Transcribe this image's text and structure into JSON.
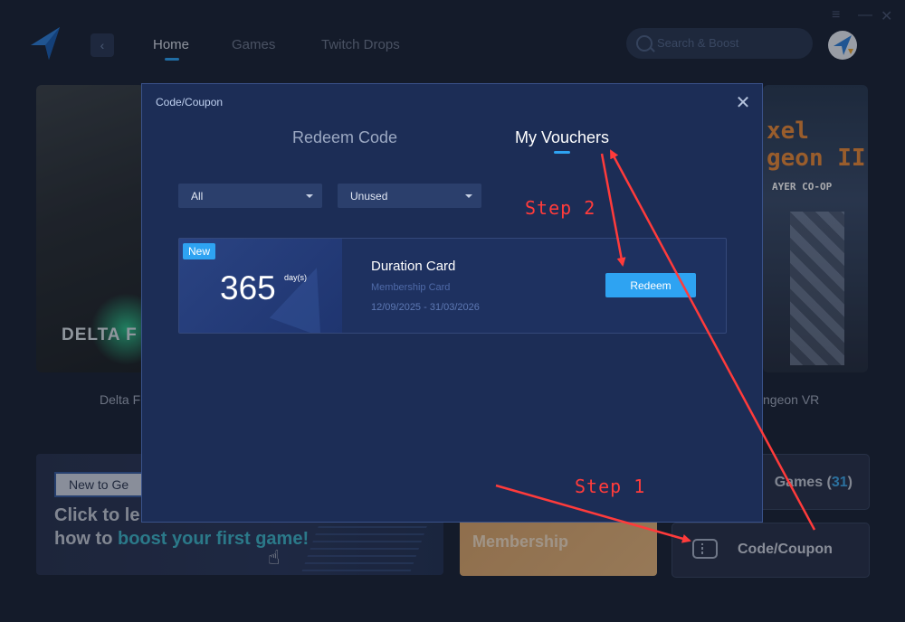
{
  "nav": {
    "items": [
      {
        "label": "Home"
      },
      {
        "label": "Games"
      },
      {
        "label": "Twitch Drops"
      }
    ]
  },
  "search": {
    "placeholder": "Search & Boost"
  },
  "background": {
    "card_left_brand": "DELTA F",
    "card_left_caption": "Delta F",
    "card_right_title": "xel geon II",
    "card_right_subtitle": "AYER CO-OP",
    "card_right_caption": "ngeon VR",
    "banner_tag": "New to Ge",
    "banner_line1": "Click to le",
    "banner_line2_pre": "how to ",
    "banner_line2_hl": "boost your first game!",
    "membership_label": "Membership",
    "games_label": "Games (",
    "games_count": "31",
    "games_close": ")",
    "coupon_label": "Code/Coupon"
  },
  "modal": {
    "title": "Code/Coupon",
    "tabs": [
      {
        "label": "Redeem Code"
      },
      {
        "label": "My Vouchers"
      }
    ],
    "filters": [
      {
        "value": "All"
      },
      {
        "value": "Unused"
      }
    ],
    "voucher": {
      "badge": "New",
      "days": "365",
      "days_unit": "day(s)",
      "title": "Duration Card",
      "subtitle": "Membership Card",
      "dates": "12/09/2025 - 31/03/2026",
      "button": "Redeem"
    }
  },
  "annotations": {
    "step1": "Step 1",
    "step2": "Step 2",
    "arrow_color": "#ff3b3b"
  },
  "colors": {
    "accent": "#2ea3f2",
    "modal_bg": "#1c2d56",
    "app_bg": "#1c2537"
  }
}
